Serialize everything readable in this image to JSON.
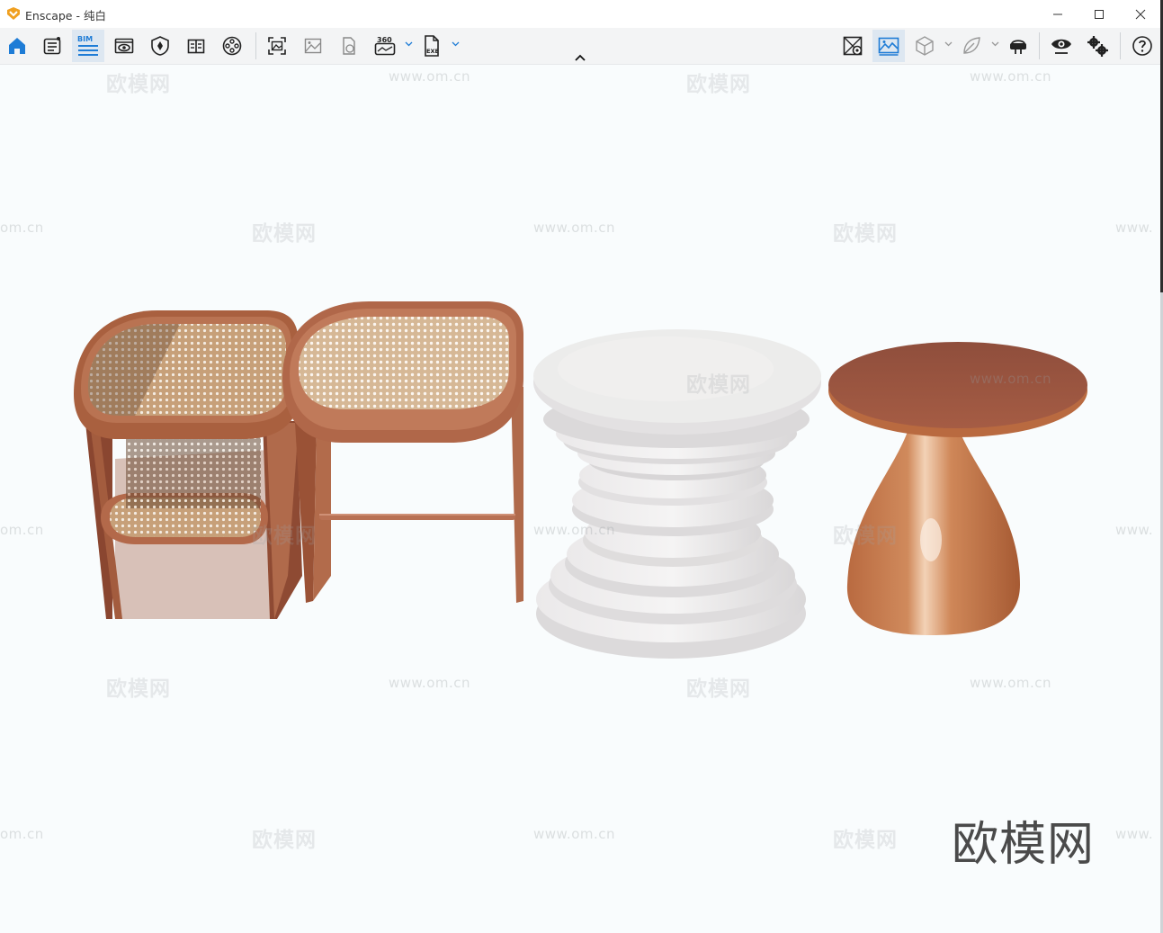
{
  "window": {
    "app_name": "Enscape",
    "title_separator": " - ",
    "document_name": "纯白"
  },
  "toolbar": {
    "bim_badge": "BIM",
    "pano_badge": "360",
    "exe_badge": "EXE",
    "left_tools": [
      {
        "name": "home",
        "icon": "home-icon",
        "active": false
      },
      {
        "name": "asset-library",
        "icon": "asset-library-icon",
        "active": false
      },
      {
        "name": "bim-mode",
        "icon": "bim-icon",
        "active": true
      },
      {
        "name": "views",
        "icon": "eye-view-icon",
        "active": false
      },
      {
        "name": "sync",
        "icon": "sync-shield-icon",
        "active": false
      },
      {
        "name": "book",
        "icon": "book-icon",
        "active": false
      },
      {
        "name": "video-editor",
        "icon": "film-reel-icon",
        "active": false
      },
      {
        "name": "screenshot",
        "icon": "screenshot-icon",
        "active": false
      },
      {
        "name": "batch-render",
        "icon": "image-icon",
        "active": false
      },
      {
        "name": "web-standalone",
        "icon": "web-export-icon",
        "active": false
      },
      {
        "name": "panorama",
        "icon": "panorama-360-icon",
        "active": false
      },
      {
        "name": "exe-export",
        "icon": "exe-export-icon",
        "active": false
      }
    ],
    "right_tools": [
      {
        "name": "collaborative-annotation",
        "icon": "map-pin-icon",
        "active": false
      },
      {
        "name": "visual-settings",
        "icon": "landscape-icon",
        "active": true
      },
      {
        "name": "material-editor",
        "icon": "cube-icon",
        "active": false
      },
      {
        "name": "leaf",
        "icon": "leaf-icon",
        "active": false
      },
      {
        "name": "vr-headset",
        "icon": "vr-headset-icon",
        "active": false
      },
      {
        "name": "view-settings",
        "icon": "eye-icon",
        "active": false
      },
      {
        "name": "settings",
        "icon": "gears-icon",
        "active": false
      },
      {
        "name": "help",
        "icon": "help-icon",
        "active": false
      }
    ]
  },
  "viewport": {
    "watermark_text": "欧模网",
    "watermark_url": "www.om.cn",
    "watermark_partial_url": "om.cn",
    "watermark_edge_url": "www.",
    "brand_logo_text": "欧模网",
    "scene_objects": [
      "rattan-nesting-table-low",
      "rattan-nesting-table-high",
      "stacked-disc-side-table",
      "copper-mushroom-side-table"
    ]
  },
  "colors": {
    "accent": "#1e7cd6",
    "active_bg": "#dde7f1",
    "copper": "#b8704e",
    "rattan": "#c9a27a",
    "stone_white": "#eceaea"
  }
}
